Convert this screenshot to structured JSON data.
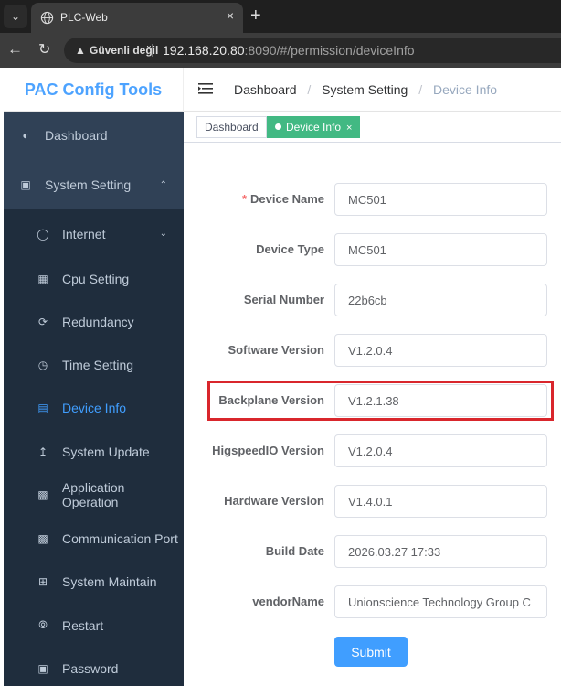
{
  "browser": {
    "tab_title": "PLC-Web",
    "tab_close": "×",
    "new_tab": "+",
    "security_label": "Güvenli değil",
    "url_host": "192.168.20.80",
    "url_rest": ":8090/#/permission/deviceInfo"
  },
  "header": {
    "brand": "PAC Config Tools",
    "breadcrumb": [
      "Dashboard",
      "System Setting",
      "Device Info"
    ],
    "separator": "/"
  },
  "sidebar": {
    "items": [
      {
        "label": "Dashboard",
        "icon": "dashboard-icon"
      },
      {
        "label": "System Setting",
        "icon": "monitor-icon",
        "expanded": true
      },
      {
        "label": "Internet",
        "icon": "globe-icon"
      },
      {
        "label": "Cpu Setting",
        "icon": "cpu-icon"
      },
      {
        "label": "Redundancy",
        "icon": "redundancy-icon"
      },
      {
        "label": "Time Setting",
        "icon": "clock-icon"
      },
      {
        "label": "Device Info",
        "icon": "device-info-icon",
        "active": true
      },
      {
        "label": "System Update",
        "icon": "upload-icon"
      },
      {
        "label": "Application Operation",
        "icon": "application-icon"
      },
      {
        "label": "Communication Port",
        "icon": "port-icon"
      },
      {
        "label": "System Maintain",
        "icon": "grid-icon"
      },
      {
        "label": "Restart",
        "icon": "restart-icon"
      },
      {
        "label": "Password",
        "icon": "lock-icon"
      }
    ]
  },
  "tags": [
    {
      "label": "Dashboard",
      "active": false
    },
    {
      "label": "Device Info",
      "active": true,
      "close": "×"
    }
  ],
  "form": {
    "fields": [
      {
        "label": "Device Name",
        "value": "MC501",
        "required": "*"
      },
      {
        "label": "Device Type",
        "value": "MC501"
      },
      {
        "label": "Serial Number",
        "value": "22b6cb"
      },
      {
        "label": "Software Version",
        "value": "V1.2.0.4"
      },
      {
        "label": "Backplane Version",
        "value": "V1.2.1.38",
        "highlighted": true
      },
      {
        "label": "HigspeedIO Version",
        "value": "V1.2.0.4"
      },
      {
        "label": "Hardware Version",
        "value": "V1.4.0.1"
      },
      {
        "label": "Build Date",
        "value": "2026.03.27 17:33"
      },
      {
        "label": "vendorName",
        "value": "Unionscience Technology Group C"
      }
    ],
    "submit_label": "Submit"
  },
  "colors": {
    "sidebar_bg": "#304156",
    "submenu_bg": "#1f2d3d",
    "accent": "#409eff",
    "brand": "#4da3ff",
    "tag_active": "#42b983",
    "highlight_border": "#d9262c"
  }
}
